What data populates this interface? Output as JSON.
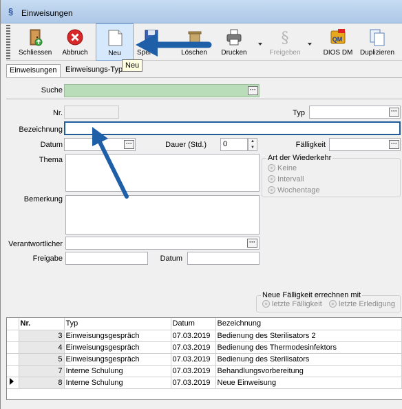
{
  "window": {
    "title": "Einweisungen"
  },
  "toolbar": {
    "buttons": [
      {
        "label": "Schliessen"
      },
      {
        "label": "Abbruch"
      },
      {
        "label": "Neu"
      },
      {
        "label": "Speichern"
      },
      {
        "label": "Löschen"
      },
      {
        "label": "Drucken"
      },
      {
        "label": "Freigeben"
      },
      {
        "label": "DIOS DM"
      },
      {
        "label": "Duplizieren"
      }
    ],
    "tooltip": "Neu"
  },
  "tabs": [
    {
      "label": "Einweisungen"
    },
    {
      "label": "Einweisungs-Typen"
    }
  ],
  "form": {
    "suche_label": "Suche",
    "nr_label": "Nr.",
    "typ_label": "Typ",
    "bezeichnung_label": "Bezeichnung",
    "datum_label": "Datum",
    "dauer_label": "Dauer (Std.)",
    "dauer_value": "0",
    "faelligkeit_label": "Fälligkeit",
    "thema_label": "Thema",
    "bemerkung_label": "Bemerkung",
    "verantwortlicher_label": "Verantwortlicher",
    "freigabe_label": "Freigabe",
    "freigabe_datum_label": "Datum",
    "wiederkehr": {
      "title": "Art der Wiederkehr",
      "options": [
        {
          "label": "Keine"
        },
        {
          "label": "Intervall"
        },
        {
          "label": "Wochentage"
        }
      ]
    },
    "neue_faelligkeit": {
      "title": "Neue Fälligkeit errechnen mit",
      "options": [
        {
          "label": "letzte Fälligkeit"
        },
        {
          "label": "letzte Erledigung"
        }
      ]
    }
  },
  "grid": {
    "headers": {
      "nr": "Nr.",
      "typ": "Typ",
      "datum": "Datum",
      "bezeichnung": "Bezeichnung"
    },
    "rows": [
      {
        "nr": "3",
        "typ": "Einweisungsgespräch",
        "datum": "07.03.2019",
        "bezeichnung": "Bedienung des Sterilisators 2"
      },
      {
        "nr": "4",
        "typ": "Einweisungsgespräch",
        "datum": "07.03.2019",
        "bezeichnung": "Bedienung des Thermodesinfektors"
      },
      {
        "nr": "5",
        "typ": "Einweisungsgespräch",
        "datum": "07.03.2019",
        "bezeichnung": "Bedienung des Sterilisators"
      },
      {
        "nr": "7",
        "typ": "Interne Schulung",
        "datum": "07.03.2019",
        "bezeichnung": "Behandlungsvorbereitung"
      },
      {
        "nr": "8",
        "typ": "Interne Schulung",
        "datum": "07.03.2019",
        "bezeichnung": "Neue Einweisung"
      }
    ]
  },
  "colors": {
    "annotation_arrow": "#1f5fa8",
    "focus_border": "#1f5c99",
    "search_bg": "#b9dcb9"
  }
}
